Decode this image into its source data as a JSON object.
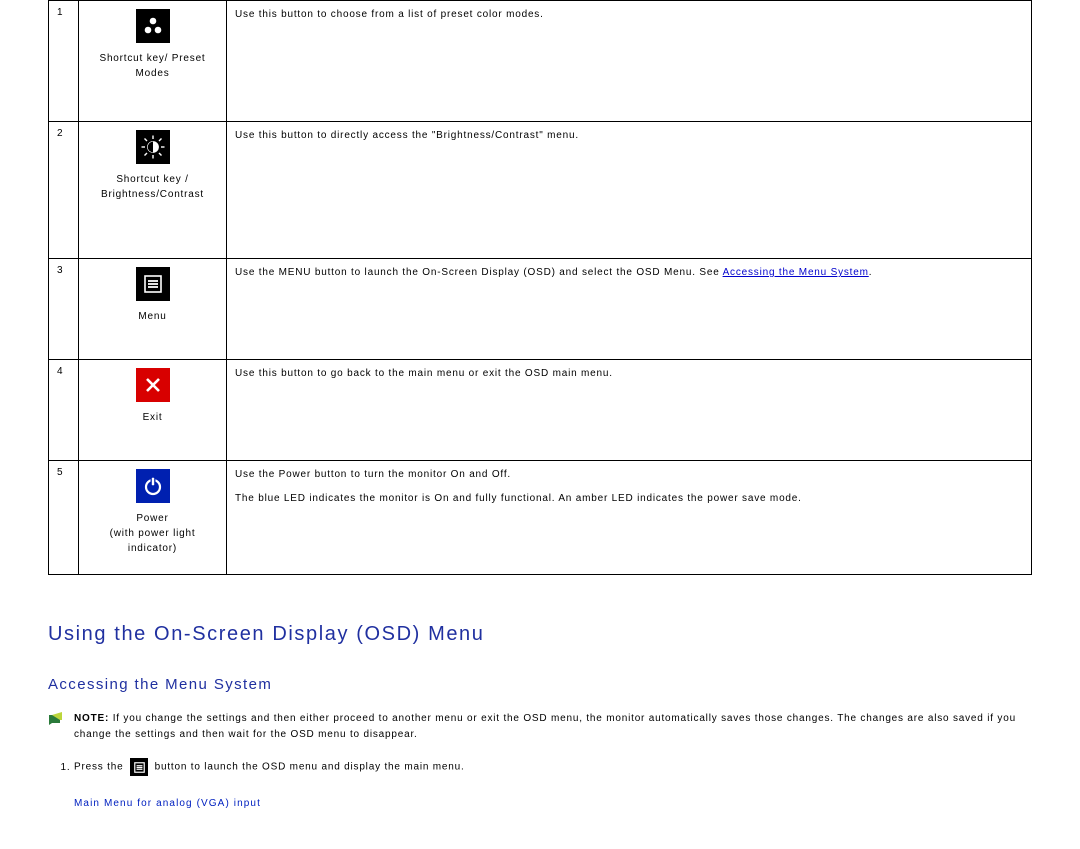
{
  "table": {
    "rows": [
      {
        "num": "1",
        "label": "Shortcut key/ Preset Modes",
        "desc": "Use this button to choose from a list of preset color modes."
      },
      {
        "num": "2",
        "label": "Shortcut key / Brightness/Contrast",
        "desc": "Use this button to directly access the \"Brightness/Contrast\" menu."
      },
      {
        "num": "3",
        "label": "Menu",
        "desc_pre": "Use the MENU button to launch the On-Screen Display (OSD) and select the OSD Menu. See ",
        "link": "Accessing the Menu System",
        "desc_post": "."
      },
      {
        "num": "4",
        "label": "Exit",
        "desc": "Use this button to go back to the main menu or exit the OSD main menu."
      },
      {
        "num": "5",
        "label": "Power\n(with power light indicator)",
        "desc_a": "Use the Power button to turn the monitor On and Off.",
        "desc_b": "The blue LED indicates the monitor is On and fully functional. An amber LED indicates the power save mode."
      }
    ]
  },
  "headings": {
    "h1": "Using the On-Screen Display (OSD) Menu",
    "h2": "Accessing the Menu System"
  },
  "note": {
    "label": "NOTE:",
    "body": " If you change the settings and then either proceed to another menu or exit the OSD menu, the monitor automatically saves those changes. The changes are also saved if you change the settings and then wait for the OSD menu to disappear."
  },
  "steps": {
    "s1_pre": "Press the ",
    "s1_post": " button to launch the OSD menu and display the main menu."
  },
  "caption": "Main Menu for analog (VGA) input"
}
